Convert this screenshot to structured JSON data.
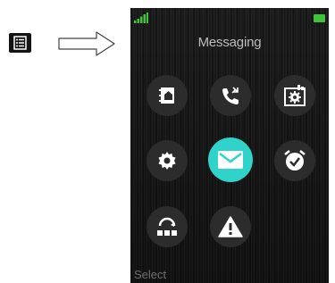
{
  "phone": {
    "title": "Messaging",
    "softkey_left": "Select"
  },
  "icons": {
    "menu_key": "menu-key-icon",
    "arrow": "right-arrow-icon",
    "signal": "signal-strength-icon",
    "battery": "battery-icon",
    "apps": [
      "contacts-icon",
      "call-log-icon",
      "device-settings-icon",
      "settings-icon",
      "messaging-icon",
      "alarm-icon",
      "connectivity-icon",
      "alert-icon"
    ]
  },
  "colors": {
    "selected_accent": "#2fd3c9",
    "signal": "#3ec33b",
    "battery": "#3ec33b"
  }
}
